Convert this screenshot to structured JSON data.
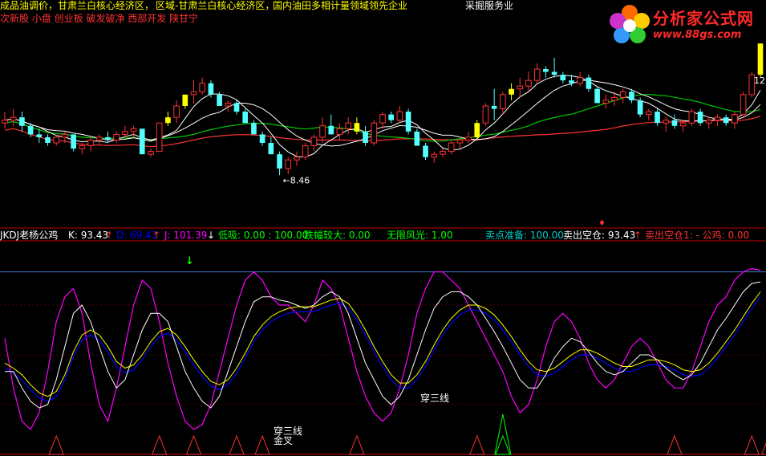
{
  "header": {
    "ticker_line1_a": "成品油调价，甘肃兰白核心经济区，",
    "ticker_line1_b": "区域-甘肃兰白核心经济区，",
    "ticker_line1_c": "国内油田多相计量领域领先企业",
    "service_label": "采掘服务业",
    "ticker_line2": "次新股 小盘 创业板 破发破净 西部开发 陕甘宁"
  },
  "logo": {
    "title": "分析家公式网",
    "url": "www.88gs.com"
  },
  "indicator_bar": {
    "name": "JKDJ老杨公鸡",
    "k": "K: 93.43",
    "d": "D: 69.43",
    "j": "J: 101.39",
    "low_buy": "低吸: 0.00 : 100.00",
    "big_drop": "跌幅较大: 0.00",
    "limitless": "无限风光: 1.00",
    "sell_prep": "卖点准备: 100.00",
    "sell_empty": "卖出空仓: 93.43",
    "sell_empty1": "卖出空仓1: -  公鸡: 0.00"
  },
  "annotations": {
    "low_price": "8.46",
    "high_price": "12",
    "cross_three_1": "穿三线",
    "cross_three_2": "穿三线",
    "golden_cross": "金叉"
  },
  "colors": {
    "background": "#000000",
    "up_candle": "#ff3232",
    "down_candle": "#54ffff",
    "limit_up": "#ffff00",
    "ma_short": "#ffffff",
    "ma_mid": "#ffff00",
    "ma_green": "#00c800",
    "ma_red": "#ff3232",
    "k_line": "#ffffff",
    "d_line": "#ffff00",
    "j_line": "#ff00ff",
    "d2_line": "#0000ff",
    "divider": "#c00000"
  },
  "chart_data": [
    {
      "type": "candlestick",
      "title": "",
      "ohlc": [
        [
          11.3,
          11.7,
          11.1,
          11.4
        ],
        [
          11.4,
          11.8,
          11.2,
          11.5
        ],
        [
          11.5,
          11.7,
          11.0,
          11.2
        ],
        [
          11.2,
          11.3,
          10.8,
          10.9
        ],
        [
          10.9,
          11.1,
          10.6,
          10.8
        ],
        [
          10.8,
          10.9,
          10.5,
          10.6
        ],
        [
          10.6,
          10.9,
          10.5,
          10.8
        ],
        [
          10.8,
          11.0,
          10.6,
          10.9
        ],
        [
          10.9,
          10.9,
          10.3,
          10.4
        ],
        [
          10.4,
          10.6,
          10.2,
          10.5
        ],
        [
          10.5,
          10.8,
          10.3,
          10.7
        ],
        [
          10.7,
          10.9,
          10.5,
          10.8
        ],
        [
          10.8,
          11.0,
          10.6,
          10.7
        ],
        [
          10.7,
          11.0,
          10.6,
          10.9
        ],
        [
          10.9,
          11.2,
          10.8,
          11.0
        ],
        [
          11.0,
          11.2,
          10.8,
          11.1
        ],
        [
          11.1,
          11.1,
          10.2,
          10.2
        ],
        [
          10.2,
          10.4,
          10.1,
          10.3
        ],
        [
          10.3,
          11.3,
          10.3,
          11.3
        ],
        [
          11.3,
          11.7,
          11.2,
          11.5
        ],
        [
          11.5,
          12.1,
          11.3,
          11.9
        ],
        [
          11.9,
          12.3,
          11.8,
          12.3
        ],
        [
          12.3,
          12.8,
          12.0,
          12.4
        ],
        [
          12.4,
          12.9,
          12.3,
          12.7
        ],
        [
          12.7,
          12.8,
          12.2,
          12.3
        ],
        [
          12.3,
          12.4,
          11.9,
          11.9
        ],
        [
          11.9,
          12.1,
          11.7,
          12.0
        ],
        [
          12.0,
          12.1,
          11.6,
          11.7
        ],
        [
          11.7,
          11.8,
          11.3,
          11.3
        ],
        [
          11.3,
          11.4,
          10.9,
          10.9
        ],
        [
          10.9,
          11.0,
          10.5,
          10.6
        ],
        [
          10.6,
          10.8,
          10.2,
          10.2
        ],
        [
          10.2,
          10.3,
          9.46,
          9.7
        ],
        [
          9.7,
          10.1,
          9.5,
          10.0
        ],
        [
          10.0,
          10.3,
          9.8,
          10.1
        ],
        [
          10.1,
          10.6,
          10.0,
          10.5
        ],
        [
          10.5,
          10.9,
          10.3,
          10.8
        ],
        [
          10.8,
          11.5,
          10.6,
          11.2
        ],
        [
          11.2,
          11.6,
          10.9,
          10.9
        ],
        [
          10.9,
          11.3,
          10.7,
          11.1
        ],
        [
          11.1,
          11.5,
          10.9,
          11.3
        ],
        [
          11.3,
          11.5,
          10.9,
          11.0
        ],
        [
          11.0,
          11.2,
          10.5,
          10.6
        ],
        [
          10.6,
          11.4,
          10.5,
          11.3
        ],
        [
          11.3,
          11.7,
          11.1,
          11.6
        ],
        [
          11.6,
          11.7,
          11.3,
          11.4
        ],
        [
          11.4,
          11.9,
          11.3,
          11.7
        ],
        [
          11.7,
          11.8,
          10.9,
          11.0
        ],
        [
          11.0,
          11.1,
          10.5,
          10.5
        ],
        [
          10.5,
          10.6,
          10.0,
          10.1
        ],
        [
          10.1,
          10.3,
          9.9,
          10.2
        ],
        [
          10.2,
          10.4,
          10.1,
          10.3
        ],
        [
          10.3,
          10.7,
          10.2,
          10.6
        ],
        [
          10.6,
          10.8,
          10.4,
          10.7
        ],
        [
          10.7,
          11.0,
          10.6,
          10.8
        ],
        [
          10.8,
          11.4,
          10.7,
          11.3
        ],
        [
          11.3,
          12.0,
          11.2,
          11.9
        ],
        [
          11.9,
          12.5,
          11.4,
          11.8
        ],
        [
          11.8,
          12.4,
          11.6,
          12.3
        ],
        [
          12.3,
          12.7,
          12.1,
          12.5
        ],
        [
          12.5,
          12.9,
          12.2,
          12.6
        ],
        [
          12.6,
          13.1,
          12.4,
          12.8
        ],
        [
          12.8,
          13.4,
          12.7,
          13.2
        ],
        [
          13.2,
          13.3,
          12.9,
          13.1
        ],
        [
          13.1,
          13.6,
          12.9,
          13.0
        ],
        [
          13.0,
          13.1,
          12.7,
          12.8
        ],
        [
          12.8,
          13.0,
          12.6,
          12.7
        ],
        [
          12.7,
          13.1,
          12.6,
          12.9
        ],
        [
          12.9,
          13.0,
          12.4,
          12.5
        ],
        [
          12.5,
          12.6,
          12.0,
          12.0
        ],
        [
          12.0,
          12.3,
          11.8,
          12.1
        ],
        [
          12.1,
          12.4,
          11.9,
          12.2
        ],
        [
          12.2,
          12.5,
          12.0,
          12.4
        ],
        [
          12.4,
          12.5,
          12.0,
          12.1
        ],
        [
          12.1,
          12.2,
          11.5,
          11.6
        ],
        [
          11.6,
          11.8,
          11.4,
          11.7
        ],
        [
          11.7,
          11.8,
          11.2,
          11.3
        ],
        [
          11.3,
          11.5,
          11.0,
          11.4
        ],
        [
          11.4,
          11.6,
          11.1,
          11.2
        ],
        [
          11.2,
          11.4,
          11.0,
          11.3
        ],
        [
          11.3,
          11.8,
          11.2,
          11.7
        ],
        [
          11.7,
          11.8,
          11.2,
          11.3
        ],
        [
          11.3,
          11.5,
          11.1,
          11.4
        ],
        [
          11.4,
          11.6,
          11.2,
          11.5
        ],
        [
          11.5,
          11.6,
          11.2,
          11.3
        ],
        [
          11.3,
          11.7,
          11.1,
          11.6
        ],
        [
          11.6,
          12.4,
          11.5,
          12.3
        ],
        [
          12.3,
          13.1,
          12.2,
          13.0
        ],
        [
          13.0,
          14.1,
          12.9,
          14.1
        ]
      ],
      "limit_up_index": [
        19,
        21,
        41,
        55,
        59,
        88
      ],
      "low_label_index": 32,
      "ylim": [
        8.0,
        14.5
      ]
    },
    {
      "type": "line",
      "title": "JKDJ老杨公鸡",
      "series_j": [
        60,
        30,
        10,
        5,
        15,
        40,
        70,
        85,
        90,
        75,
        45,
        20,
        10,
        30,
        55,
        80,
        95,
        90,
        70,
        45,
        25,
        10,
        5,
        8,
        20,
        40,
        60,
        80,
        95,
        100,
        95,
        85,
        80,
        80,
        75,
        70,
        80,
        95,
        90,
        80,
        60,
        40,
        25,
        15,
        10,
        15,
        30,
        50,
        75,
        90,
        100,
        100,
        95,
        90,
        80,
        70,
        60,
        50,
        40,
        25,
        15,
        20,
        35,
        55,
        70,
        75,
        70,
        60,
        45,
        35,
        30,
        35,
        45,
        55,
        60,
        55,
        45,
        35,
        30,
        30,
        40,
        55,
        70,
        80,
        85,
        95,
        100,
        102,
        101
      ],
      "series_k": [
        40,
        40,
        30,
        22,
        18,
        20,
        35,
        55,
        75,
        80,
        70,
        55,
        40,
        30,
        35,
        50,
        65,
        75,
        75,
        70,
        55,
        40,
        30,
        22,
        18,
        25,
        40,
        55,
        70,
        82,
        85,
        85,
        83,
        82,
        80,
        78,
        80,
        85,
        88,
        85,
        75,
        60,
        45,
        35,
        25,
        20,
        25,
        35,
        50,
        65,
        78,
        85,
        88,
        88,
        85,
        80,
        72,
        64,
        55,
        45,
        35,
        30,
        30,
        38,
        48,
        55,
        60,
        58,
        52,
        45,
        40,
        38,
        40,
        45,
        50,
        50,
        47,
        42,
        38,
        35,
        38,
        45,
        55,
        65,
        72,
        80,
        88,
        93,
        94
      ],
      "series_d": [
        45,
        42,
        38,
        32,
        27,
        25,
        28,
        38,
        52,
        62,
        65,
        62,
        55,
        46,
        42,
        44,
        50,
        58,
        64,
        66,
        62,
        55,
        47,
        40,
        34,
        32,
        35,
        42,
        51,
        61,
        68,
        73,
        76,
        78,
        79,
        79,
        79,
        81,
        83,
        84,
        81,
        74,
        65,
        55,
        46,
        38,
        33,
        33,
        38,
        46,
        56,
        65,
        72,
        77,
        80,
        80,
        78,
        74,
        68,
        61,
        53,
        46,
        41,
        40,
        42,
        46,
        50,
        53,
        53,
        51,
        48,
        45,
        43,
        43,
        45,
        47,
        47,
        46,
        44,
        41,
        40,
        41,
        45,
        51,
        58,
        65,
        73,
        81,
        88
      ],
      "annotations": [
        "穿三线",
        "穿三线",
        "金叉"
      ],
      "ylim": [
        -10,
        110
      ]
    }
  ]
}
